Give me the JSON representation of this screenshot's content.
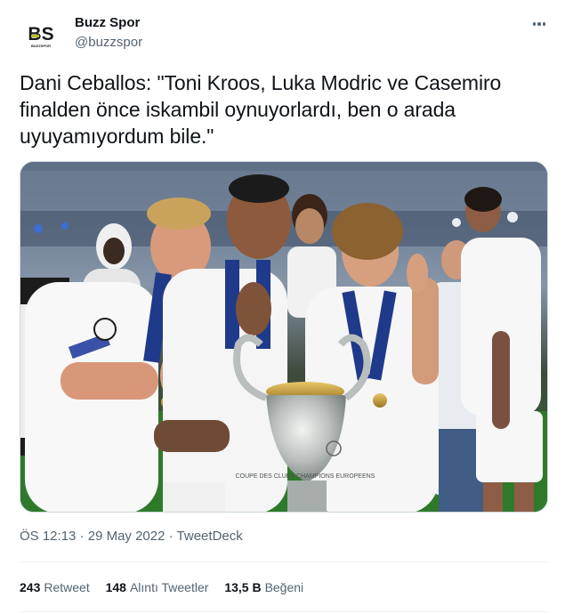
{
  "author": {
    "display_name": "Buzz Spor",
    "handle": "@buzzspor",
    "avatar_letters": "BS",
    "avatar_subtext": "BUZZSPOR"
  },
  "tweet": {
    "text": "Dani Ceballos: \"Toni Kroos, Luka Modric ve Casemiro finalden önce iskambil oynuyorlardı, ben o arada uyuyamıyordum bile.\"",
    "time": "ÖS 12:13",
    "separator": "·",
    "date": "29 May 2022",
    "source": "TweetDeck"
  },
  "stats": {
    "retweets_count": "243",
    "retweets_label": "Retweet",
    "quotes_count": "148",
    "quotes_label": "Alıntı Tweetler",
    "likes_count": "13,5 B",
    "likes_label": "Beğeni"
  },
  "media": {
    "trophy_inscription": "COUPE DES CLUBS CHAMPIONS EUROPEENS"
  },
  "colors": {
    "text": "#0f1419",
    "secondary": "#536471",
    "border": "#cfd9de",
    "avatar_accent": "#b5c224"
  }
}
